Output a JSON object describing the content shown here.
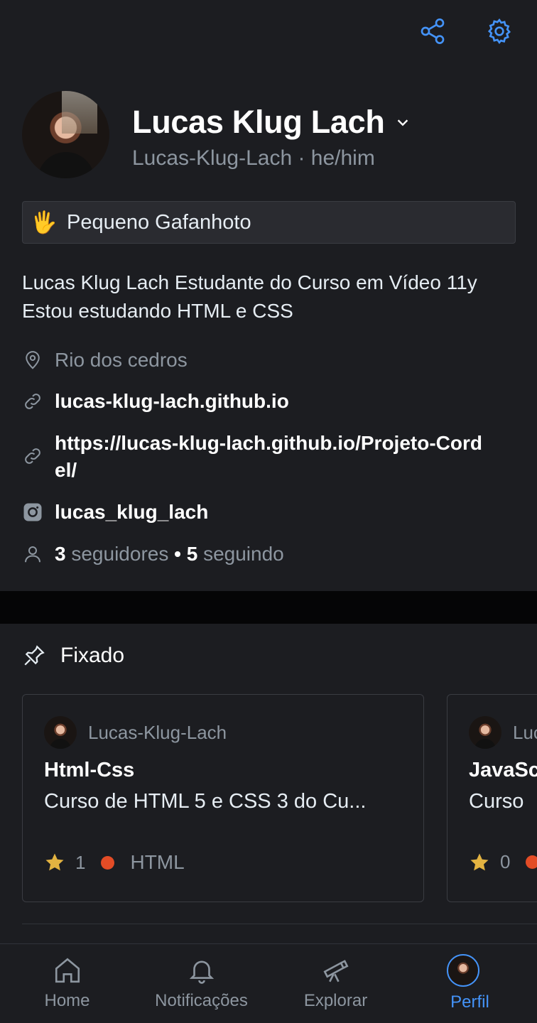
{
  "header": {
    "share_icon": "share-icon",
    "settings_icon": "gear-icon"
  },
  "profile": {
    "name": "Lucas Klug Lach",
    "handle_line": "Lucas-Klug-Lach · he/him",
    "status_emoji": "🖐️",
    "status_text": "Pequeno Gafanhoto",
    "bio": "Lucas Klug Lach Estudante do Curso em Vídeo 11y Estou estudando HTML e CSS",
    "location": "Rio dos cedros",
    "website": "lucas-klug-lach.github.io",
    "link2": "https://lucas-klug-lach.github.io/Projeto-Cordel/",
    "instagram": "lucas_klug_lach",
    "followers_count": "3",
    "followers_label": "seguidores",
    "dot": "•",
    "following_count": "5",
    "following_label": "seguindo"
  },
  "pinned": {
    "title": "Fixado",
    "cards": [
      {
        "owner": "Lucas-Klug-Lach",
        "name": "Html-Css",
        "description": "Curso de HTML 5 e CSS 3 do Cu...",
        "stars": "1",
        "language": "HTML",
        "language_color": "#e34c26"
      },
      {
        "owner": "Luc",
        "name": "JavaSc",
        "description": "Curso",
        "stars": "0",
        "language": "",
        "language_color": "#e34c26"
      }
    ]
  },
  "nav": {
    "home": "Home",
    "notifications": "Notificações",
    "explore": "Explorar",
    "profile": "Perfil",
    "active": "profile"
  },
  "colors": {
    "background": "#1c1d21",
    "accent": "#4493f8",
    "muted": "#8d96a0",
    "star": "#e3b341"
  }
}
